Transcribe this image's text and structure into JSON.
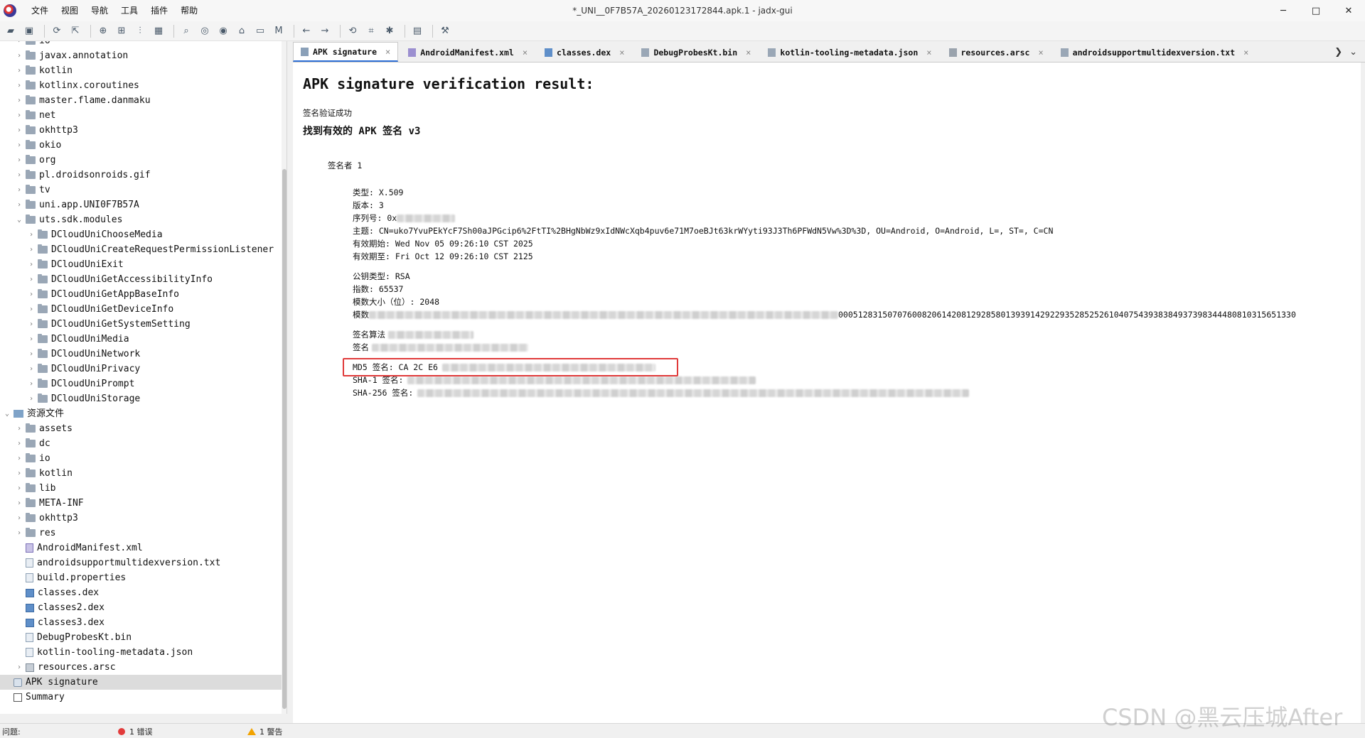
{
  "window": {
    "title": "*_UNI__0F7B57A_20260123172844.apk.1 - jadx-gui",
    "controls": {
      "minimize": "─",
      "maximize": "□",
      "close": "✕"
    }
  },
  "menu": [
    "文件",
    "视图",
    "导航",
    "工具",
    "插件",
    "帮助"
  ],
  "toolbar": {
    "icons": [
      "open-icon",
      "save-icon",
      "sync-icon",
      "export-icon",
      "add-icon",
      "tree-icon",
      "flatten-icon",
      "table-icon",
      "search-icon",
      "find-class-icon",
      "find-usage-icon",
      "home-icon",
      "log-icon",
      "m-icon",
      "back-icon",
      "forward-icon",
      "decompile-icon",
      "bookmark-icon",
      "debug-icon",
      "script-icon",
      "settings-icon"
    ]
  },
  "tree": {
    "rows": [
      {
        "label": "io",
        "depth": 1,
        "kind": "folder",
        "expanded": false
      },
      {
        "label": "javax.annotation",
        "depth": 1,
        "kind": "folder",
        "expanded": false
      },
      {
        "label": "kotlin",
        "depth": 1,
        "kind": "folder",
        "expanded": false
      },
      {
        "label": "kotlinx.coroutines",
        "depth": 1,
        "kind": "folder",
        "expanded": false
      },
      {
        "label": "master.flame.danmaku",
        "depth": 1,
        "kind": "folder",
        "expanded": false
      },
      {
        "label": "net",
        "depth": 1,
        "kind": "folder",
        "expanded": false
      },
      {
        "label": "okhttp3",
        "depth": 1,
        "kind": "folder",
        "expanded": false
      },
      {
        "label": "okio",
        "depth": 1,
        "kind": "folder",
        "expanded": false
      },
      {
        "label": "org",
        "depth": 1,
        "kind": "folder",
        "expanded": false
      },
      {
        "label": "pl.droidsonroids.gif",
        "depth": 1,
        "kind": "folder",
        "expanded": false
      },
      {
        "label": "tv",
        "depth": 1,
        "kind": "folder",
        "expanded": false
      },
      {
        "label": "uni.app.UNI0F7B57A",
        "depth": 1,
        "kind": "folder",
        "expanded": false
      },
      {
        "label": "uts.sdk.modules",
        "depth": 1,
        "kind": "folder",
        "expanded": true
      },
      {
        "label": "DCloudUniChooseMedia",
        "depth": 2,
        "kind": "folder",
        "expanded": false
      },
      {
        "label": "DCloudUniCreateRequestPermissionListener",
        "depth": 2,
        "kind": "folder",
        "expanded": false
      },
      {
        "label": "DCloudUniExit",
        "depth": 2,
        "kind": "folder",
        "expanded": false
      },
      {
        "label": "DCloudUniGetAccessibilityInfo",
        "depth": 2,
        "kind": "folder",
        "expanded": false
      },
      {
        "label": "DCloudUniGetAppBaseInfo",
        "depth": 2,
        "kind": "folder",
        "expanded": false
      },
      {
        "label": "DCloudUniGetDeviceInfo",
        "depth": 2,
        "kind": "folder",
        "expanded": false
      },
      {
        "label": "DCloudUniGetSystemSetting",
        "depth": 2,
        "kind": "folder",
        "expanded": false
      },
      {
        "label": "DCloudUniMedia",
        "depth": 2,
        "kind": "folder",
        "expanded": false
      },
      {
        "label": "DCloudUniNetwork",
        "depth": 2,
        "kind": "folder",
        "expanded": false
      },
      {
        "label": "DCloudUniPrivacy",
        "depth": 2,
        "kind": "folder",
        "expanded": false
      },
      {
        "label": "DCloudUniPrompt",
        "depth": 2,
        "kind": "folder",
        "expanded": false
      },
      {
        "label": "DCloudUniStorage",
        "depth": 2,
        "kind": "folder",
        "expanded": false
      },
      {
        "label": "资源文件",
        "depth": 0,
        "kind": "res",
        "expanded": true
      },
      {
        "label": "assets",
        "depth": 1,
        "kind": "folder",
        "expanded": false
      },
      {
        "label": "dc",
        "depth": 1,
        "kind": "folder",
        "expanded": false
      },
      {
        "label": "io",
        "depth": 1,
        "kind": "folder",
        "expanded": false
      },
      {
        "label": "kotlin",
        "depth": 1,
        "kind": "folder",
        "expanded": false
      },
      {
        "label": "lib",
        "depth": 1,
        "kind": "folder",
        "expanded": false
      },
      {
        "label": "META-INF",
        "depth": 1,
        "kind": "folder",
        "expanded": false
      },
      {
        "label": "okhttp3",
        "depth": 1,
        "kind": "folder",
        "expanded": false
      },
      {
        "label": "res",
        "depth": 1,
        "kind": "folder",
        "expanded": false
      },
      {
        "label": "AndroidManifest.xml",
        "depth": 1,
        "kind": "xml"
      },
      {
        "label": "androidsupportmultidexversion.txt",
        "depth": 1,
        "kind": "file"
      },
      {
        "label": "build.properties",
        "depth": 1,
        "kind": "file"
      },
      {
        "label": "classes.dex",
        "depth": 1,
        "kind": "dex"
      },
      {
        "label": "classes2.dex",
        "depth": 1,
        "kind": "dex"
      },
      {
        "label": "classes3.dex",
        "depth": 1,
        "kind": "dex"
      },
      {
        "label": "DebugProbesKt.bin",
        "depth": 1,
        "kind": "file"
      },
      {
        "label": "kotlin-tooling-metadata.json",
        "depth": 1,
        "kind": "file"
      },
      {
        "label": "resources.arsc",
        "depth": 1,
        "kind": "arsc",
        "expanded": false
      },
      {
        "label": "APK signature",
        "depth": 0,
        "kind": "sig",
        "selected": true
      },
      {
        "label": "Summary",
        "depth": 0,
        "kind": "summary"
      }
    ]
  },
  "tabs": [
    {
      "label": "APK signature",
      "active": true,
      "icon": "signature-icon"
    },
    {
      "label": "AndroidManifest.xml",
      "active": false,
      "icon": "xml-icon"
    },
    {
      "label": "classes.dex",
      "active": false,
      "icon": "dex-icon"
    },
    {
      "label": "DebugProbesKt.bin",
      "active": false,
      "icon": "file-icon"
    },
    {
      "label": "kotlin-tooling-metadata.json",
      "active": false,
      "icon": "file-icon"
    },
    {
      "label": "resources.arsc",
      "active": false,
      "icon": "arsc-icon"
    },
    {
      "label": "androidsupportmultidexversion.txt",
      "active": false,
      "icon": "file-icon"
    }
  ],
  "tab_close_glyph": "×",
  "signature": {
    "title": "APK signature verification result:",
    "verify_ok": "签名验证成功",
    "found": "找到有效的 APK 签名 v3",
    "signer": "签名者 1",
    "type": "类型: X.509",
    "version": "版本: 3",
    "serial_prefix": "序列号: 0x",
    "subject": "主题: CN=uko7YvuPEkYcF7Sh00aJPGcip6%2FtTI%2BHgNbWz9xIdNWcXqb4puv6e71M7oeBJt63krWYyti93J3Th6PFWdN5Vw%3D%3D, OU=Android, O=Android, L=, ST=, C=CN",
    "valid_from": "有效期始: Wed Nov 05 09:26:10 CST 2025",
    "valid_to": "有效期至: Fri Oct 12 09:26:10 CST 2125",
    "pubkey_type": "公钥类型: RSA",
    "exponent": "指数: 65537",
    "modulus_size": "模数大小（位）: 2048",
    "modulus_prefix": "模数",
    "modulus_tail": "000512831507076008206142081292858013939142922935285252610407543938384937398344480810315651330",
    "sig_algo": "签名算法",
    "sig_oid": "签名",
    "md5": "MD5 签名: CA 2C E6",
    "sha1": "SHA-1 签名:",
    "sha256": "SHA-256 签名:"
  },
  "status": {
    "problems": "问题:",
    "errors": "1 错误",
    "warnings": "1 警告"
  },
  "watermark": "CSDN @黑云压城After"
}
